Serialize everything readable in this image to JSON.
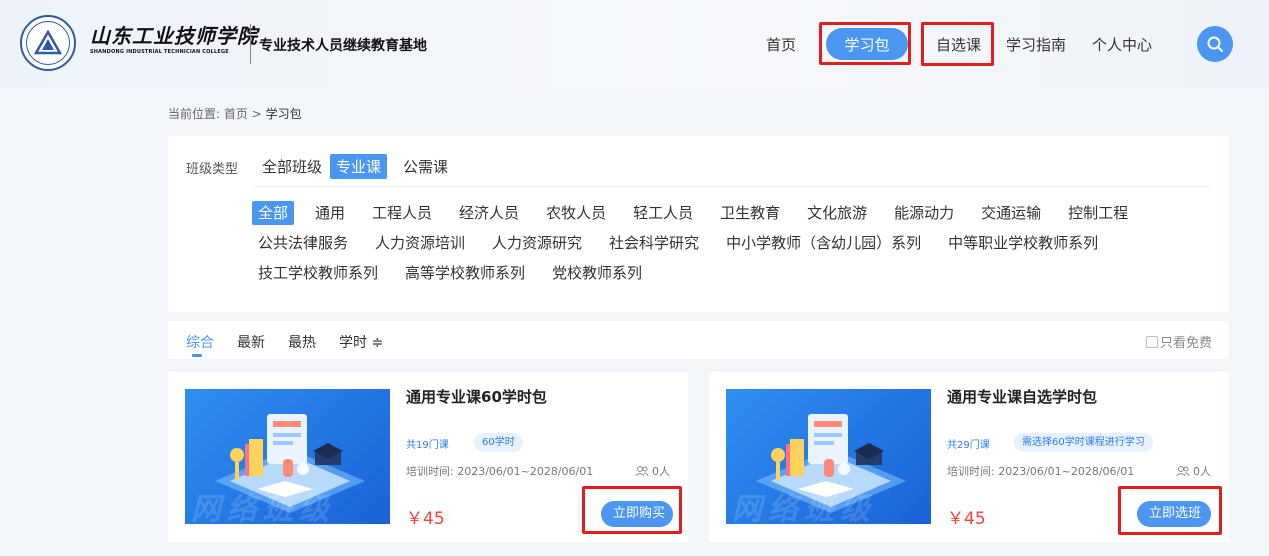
{
  "header": {
    "logo_cn": "山东工业技师学院",
    "logo_en": "SHANDONG INDUSTRIAL TECHNICIAN COLLEGE",
    "site_title": "专业技术人员继续教育基地",
    "nav": [
      "首页",
      "学习包",
      "自选课",
      "学习指南",
      "个人中心"
    ],
    "active_nav": "学习包"
  },
  "breadcrumb": {
    "prefix": "当前位置: ",
    "home": "首页",
    "separator": " > ",
    "current": "学习包"
  },
  "filter": {
    "label": "班级类型",
    "types": [
      "全部班级",
      "专业课",
      "公需课"
    ],
    "active_type": "专业课",
    "categories": [
      "全部",
      "通用",
      "工程人员",
      "经济人员",
      "农牧人员",
      "轻工人员",
      "卫生教育",
      "文化旅游",
      "能源动力",
      "交通运输",
      "控制工程",
      "公共法律服务",
      "人力资源培训",
      "人力资源研究",
      "社会科学研究",
      "中小学教师（含幼儿园）系列",
      "中等职业学校教师系列",
      "技工学校教师系列",
      "高等学校教师系列",
      "党校教师系列"
    ],
    "active_category": "全部"
  },
  "sort": {
    "items": [
      "综合",
      "最新",
      "最热",
      "学时 ≑"
    ],
    "active": "综合",
    "free_only_label": "只看免费"
  },
  "cards": [
    {
      "title": "通用专业课60学时包",
      "course_count": "共19门课",
      "tag": "60学时",
      "period": "培训时间: 2023/06/01~2028/06/01",
      "enrolled": "0人",
      "price": "￥45",
      "button": "立即购买",
      "watermark": "网络班级"
    },
    {
      "title": "通用专业课自选学时包",
      "course_count": "共29门课",
      "tag": "需选择60学时课程进行学习",
      "period": "培训时间: 2023/06/01~2028/06/01",
      "enrolled": "0人",
      "price": "￥45",
      "button": "立即选班",
      "watermark": "网络班级"
    }
  ],
  "colors": {
    "accent": "#4a96f1",
    "price": "#f2433f",
    "highlight": "#e11d1d"
  }
}
